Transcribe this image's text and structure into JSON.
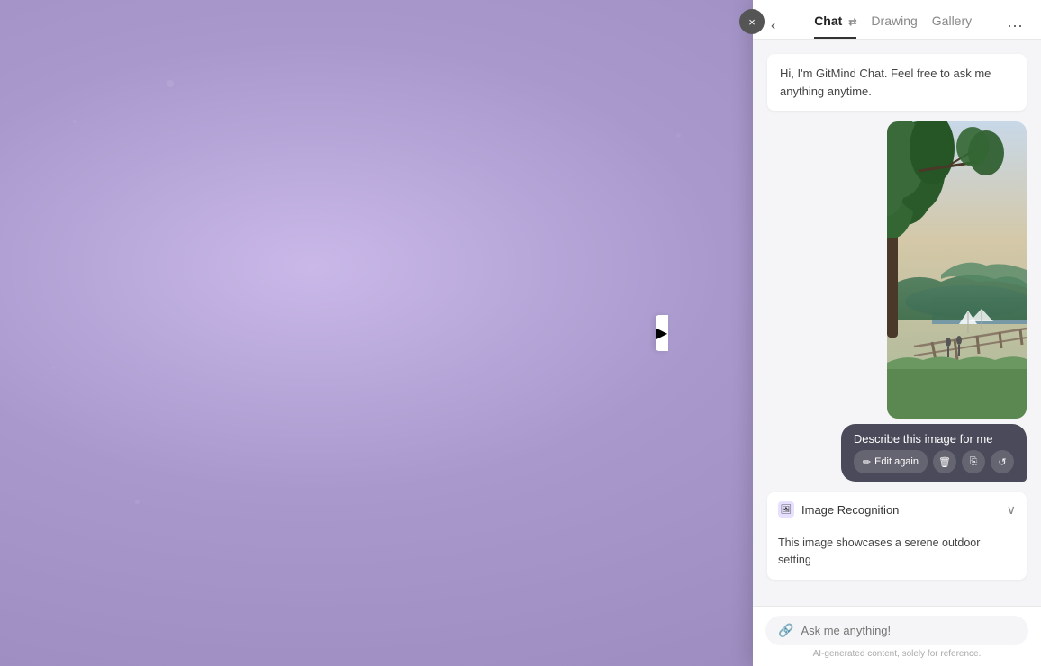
{
  "background": {
    "color": "#b8a8d9"
  },
  "close_button": {
    "symbol": "×"
  },
  "expand_handle": {
    "symbol": "▶"
  },
  "header": {
    "back_symbol": "‹",
    "tabs": [
      {
        "label": "Chat",
        "icon": "⇄",
        "active": true
      },
      {
        "label": "Drawing",
        "active": false
      },
      {
        "label": "Gallery",
        "active": false
      }
    ],
    "more_symbol": "···"
  },
  "messages": {
    "system_greeting": "Hi, I'm GitMind Chat. Feel free to ask me anything anytime.",
    "user_prompt": "Describe this image for me",
    "edit_again_label": "Edit again",
    "response_header": "Image Recognition",
    "response_text": "This image showcases a serene outdoor setting"
  },
  "input": {
    "placeholder": "Ask me anything!",
    "attach_icon": "🔗",
    "disclaimer": "AI-generated content, solely for reference."
  },
  "bubble_actions": {
    "delete_icon": "🗑",
    "copy_icon": "⎘",
    "refresh_icon": "↺"
  }
}
